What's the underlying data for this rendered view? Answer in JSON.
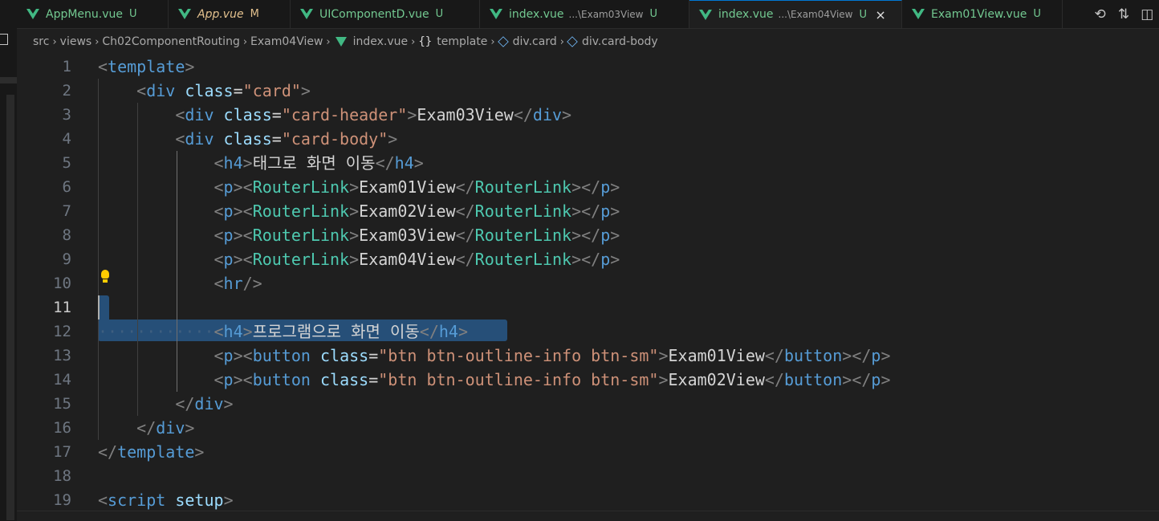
{
  "tabs": [
    {
      "label": "AppMenu.vue",
      "status": "U",
      "modified": false,
      "active": false,
      "desc": ""
    },
    {
      "label": "App.vue",
      "status": "M",
      "modified": true,
      "active": false,
      "desc": ""
    },
    {
      "label": "UIComponentD.vue",
      "status": "U",
      "modified": false,
      "active": false,
      "desc": ""
    },
    {
      "label": "index.vue",
      "status": "U",
      "modified": false,
      "active": false,
      "desc": "...\\Exam03View"
    },
    {
      "label": "index.vue",
      "status": "U",
      "modified": false,
      "active": true,
      "desc": "...\\Exam04View",
      "close": "×"
    },
    {
      "label": "Exam01View.vue",
      "status": "U",
      "modified": false,
      "active": false,
      "desc": ""
    }
  ],
  "tab_actions": [
    "timeline-icon",
    "git-compare-icon"
  ],
  "breadcrumb": {
    "src": "src",
    "views": "views",
    "folder": "Ch02ComponentRouting",
    "subfolder": "Exam04View",
    "file": "index.vue",
    "template": "template",
    "card": "div.card",
    "card_body": "div.card-body"
  },
  "lines": [
    {
      "n": "1",
      "html": [
        [
          "p",
          "<"
        ],
        [
          "t",
          "template"
        ],
        [
          "p",
          ">"
        ]
      ]
    },
    {
      "n": "2",
      "html": [
        [
          "x",
          "    "
        ],
        [
          "p",
          "<"
        ],
        [
          "t",
          "div"
        ],
        [
          "x",
          " "
        ],
        [
          "a",
          "class"
        ],
        [
          "x",
          "="
        ],
        [
          "s",
          "\"card\""
        ],
        [
          "p",
          ">"
        ]
      ]
    },
    {
      "n": "3",
      "html": [
        [
          "x",
          "        "
        ],
        [
          "p",
          "<"
        ],
        [
          "t",
          "div"
        ],
        [
          "x",
          " "
        ],
        [
          "a",
          "class"
        ],
        [
          "x",
          "="
        ],
        [
          "s",
          "\"card-header\""
        ],
        [
          "p",
          ">"
        ],
        [
          "x",
          "Exam03View"
        ],
        [
          "p",
          "</"
        ],
        [
          "t",
          "div"
        ],
        [
          "p",
          ">"
        ]
      ]
    },
    {
      "n": "4",
      "html": [
        [
          "x",
          "        "
        ],
        [
          "p",
          "<"
        ],
        [
          "t",
          "div"
        ],
        [
          "x",
          " "
        ],
        [
          "a",
          "class"
        ],
        [
          "x",
          "="
        ],
        [
          "s",
          "\"card-body\""
        ],
        [
          "p",
          ">"
        ]
      ]
    },
    {
      "n": "5",
      "html": [
        [
          "x",
          "            "
        ],
        [
          "p",
          "<"
        ],
        [
          "t",
          "h4"
        ],
        [
          "p",
          ">"
        ],
        [
          "x",
          "태그로 화면 이동"
        ],
        [
          "p",
          "</"
        ],
        [
          "t",
          "h4"
        ],
        [
          "p",
          ">"
        ]
      ]
    },
    {
      "n": "6",
      "html": [
        [
          "x",
          "            "
        ],
        [
          "p",
          "<"
        ],
        [
          "t",
          "p"
        ],
        [
          "p",
          ">"
        ],
        [
          "p",
          "<"
        ],
        [
          "c",
          "RouterLink"
        ],
        [
          "p",
          ">"
        ],
        [
          "x",
          "Exam01View"
        ],
        [
          "p",
          "</"
        ],
        [
          "c",
          "RouterLink"
        ],
        [
          "p",
          ">"
        ],
        [
          "p",
          "</"
        ],
        [
          "t",
          "p"
        ],
        [
          "p",
          ">"
        ]
      ]
    },
    {
      "n": "7",
      "html": [
        [
          "x",
          "            "
        ],
        [
          "p",
          "<"
        ],
        [
          "t",
          "p"
        ],
        [
          "p",
          ">"
        ],
        [
          "p",
          "<"
        ],
        [
          "c",
          "RouterLink"
        ],
        [
          "p",
          ">"
        ],
        [
          "x",
          "Exam02View"
        ],
        [
          "p",
          "</"
        ],
        [
          "c",
          "RouterLink"
        ],
        [
          "p",
          ">"
        ],
        [
          "p",
          "</"
        ],
        [
          "t",
          "p"
        ],
        [
          "p",
          ">"
        ]
      ]
    },
    {
      "n": "8",
      "html": [
        [
          "x",
          "            "
        ],
        [
          "p",
          "<"
        ],
        [
          "t",
          "p"
        ],
        [
          "p",
          ">"
        ],
        [
          "p",
          "<"
        ],
        [
          "c",
          "RouterLink"
        ],
        [
          "p",
          ">"
        ],
        [
          "x",
          "Exam03View"
        ],
        [
          "p",
          "</"
        ],
        [
          "c",
          "RouterLink"
        ],
        [
          "p",
          ">"
        ],
        [
          "p",
          "</"
        ],
        [
          "t",
          "p"
        ],
        [
          "p",
          ">"
        ]
      ]
    },
    {
      "n": "9",
      "html": [
        [
          "x",
          "            "
        ],
        [
          "p",
          "<"
        ],
        [
          "t",
          "p"
        ],
        [
          "p",
          ">"
        ],
        [
          "p",
          "<"
        ],
        [
          "c",
          "RouterLink"
        ],
        [
          "p",
          ">"
        ],
        [
          "x",
          "Exam04View"
        ],
        [
          "p",
          "</"
        ],
        [
          "c",
          "RouterLink"
        ],
        [
          "p",
          ">"
        ],
        [
          "p",
          "</"
        ],
        [
          "t",
          "p"
        ],
        [
          "p",
          ">"
        ]
      ]
    },
    {
      "n": "10",
      "html": [
        [
          "x",
          "            "
        ],
        [
          "p",
          "<"
        ],
        [
          "t",
          "hr"
        ],
        [
          "p",
          "/>"
        ]
      ]
    },
    {
      "n": "11",
      "html": []
    },
    {
      "n": "12",
      "html": [
        [
          "w",
          "············"
        ],
        [
          "p",
          "<"
        ],
        [
          "t",
          "h4"
        ],
        [
          "p",
          ">"
        ],
        [
          "x",
          "프로그램으로 화면 이동"
        ],
        [
          "p",
          "</"
        ],
        [
          "t",
          "h4"
        ],
        [
          "p",
          ">"
        ]
      ]
    },
    {
      "n": "13",
      "html": [
        [
          "x",
          "            "
        ],
        [
          "p",
          "<"
        ],
        [
          "t",
          "p"
        ],
        [
          "p",
          ">"
        ],
        [
          "p",
          "<"
        ],
        [
          "t",
          "button"
        ],
        [
          "x",
          " "
        ],
        [
          "a",
          "class"
        ],
        [
          "x",
          "="
        ],
        [
          "s",
          "\"btn btn-outline-info btn-sm\""
        ],
        [
          "p",
          ">"
        ],
        [
          "x",
          "Exam01View"
        ],
        [
          "p",
          "</"
        ],
        [
          "t",
          "button"
        ],
        [
          "p",
          ">"
        ],
        [
          "p",
          "</"
        ],
        [
          "t",
          "p"
        ],
        [
          "p",
          ">"
        ]
      ]
    },
    {
      "n": "14",
      "html": [
        [
          "x",
          "            "
        ],
        [
          "p",
          "<"
        ],
        [
          "t",
          "p"
        ],
        [
          "p",
          ">"
        ],
        [
          "p",
          "<"
        ],
        [
          "t",
          "button"
        ],
        [
          "x",
          " "
        ],
        [
          "a",
          "class"
        ],
        [
          "x",
          "="
        ],
        [
          "s",
          "\"btn btn-outline-info btn-sm\""
        ],
        [
          "p",
          ">"
        ],
        [
          "x",
          "Exam02View"
        ],
        [
          "p",
          "</"
        ],
        [
          "t",
          "button"
        ],
        [
          "p",
          ">"
        ],
        [
          "p",
          "</"
        ],
        [
          "t",
          "p"
        ],
        [
          "p",
          ">"
        ]
      ]
    },
    {
      "n": "15",
      "html": [
        [
          "x",
          "        "
        ],
        [
          "p",
          "</"
        ],
        [
          "t",
          "div"
        ],
        [
          "p",
          ">"
        ]
      ]
    },
    {
      "n": "16",
      "html": [
        [
          "x",
          "    "
        ],
        [
          "p",
          "</"
        ],
        [
          "t",
          "div"
        ],
        [
          "p",
          ">"
        ]
      ]
    },
    {
      "n": "17",
      "html": [
        [
          "p",
          "</"
        ],
        [
          "t",
          "template"
        ],
        [
          "p",
          ">"
        ]
      ]
    },
    {
      "n": "18",
      "html": []
    },
    {
      "n": "19",
      "html": [
        [
          "p",
          "<"
        ],
        [
          "t",
          "script"
        ],
        [
          "x",
          " "
        ],
        [
          "a",
          "setup"
        ],
        [
          "p",
          ">"
        ]
      ]
    }
  ],
  "current_line": "11",
  "colors": {
    "background": "#1f1f1f",
    "selection": "#264f78",
    "tag": "#569cd6",
    "component": "#4ec9b0",
    "attribute": "#9cdcfe",
    "string": "#ce9178",
    "vue_icon": "#41b883"
  }
}
